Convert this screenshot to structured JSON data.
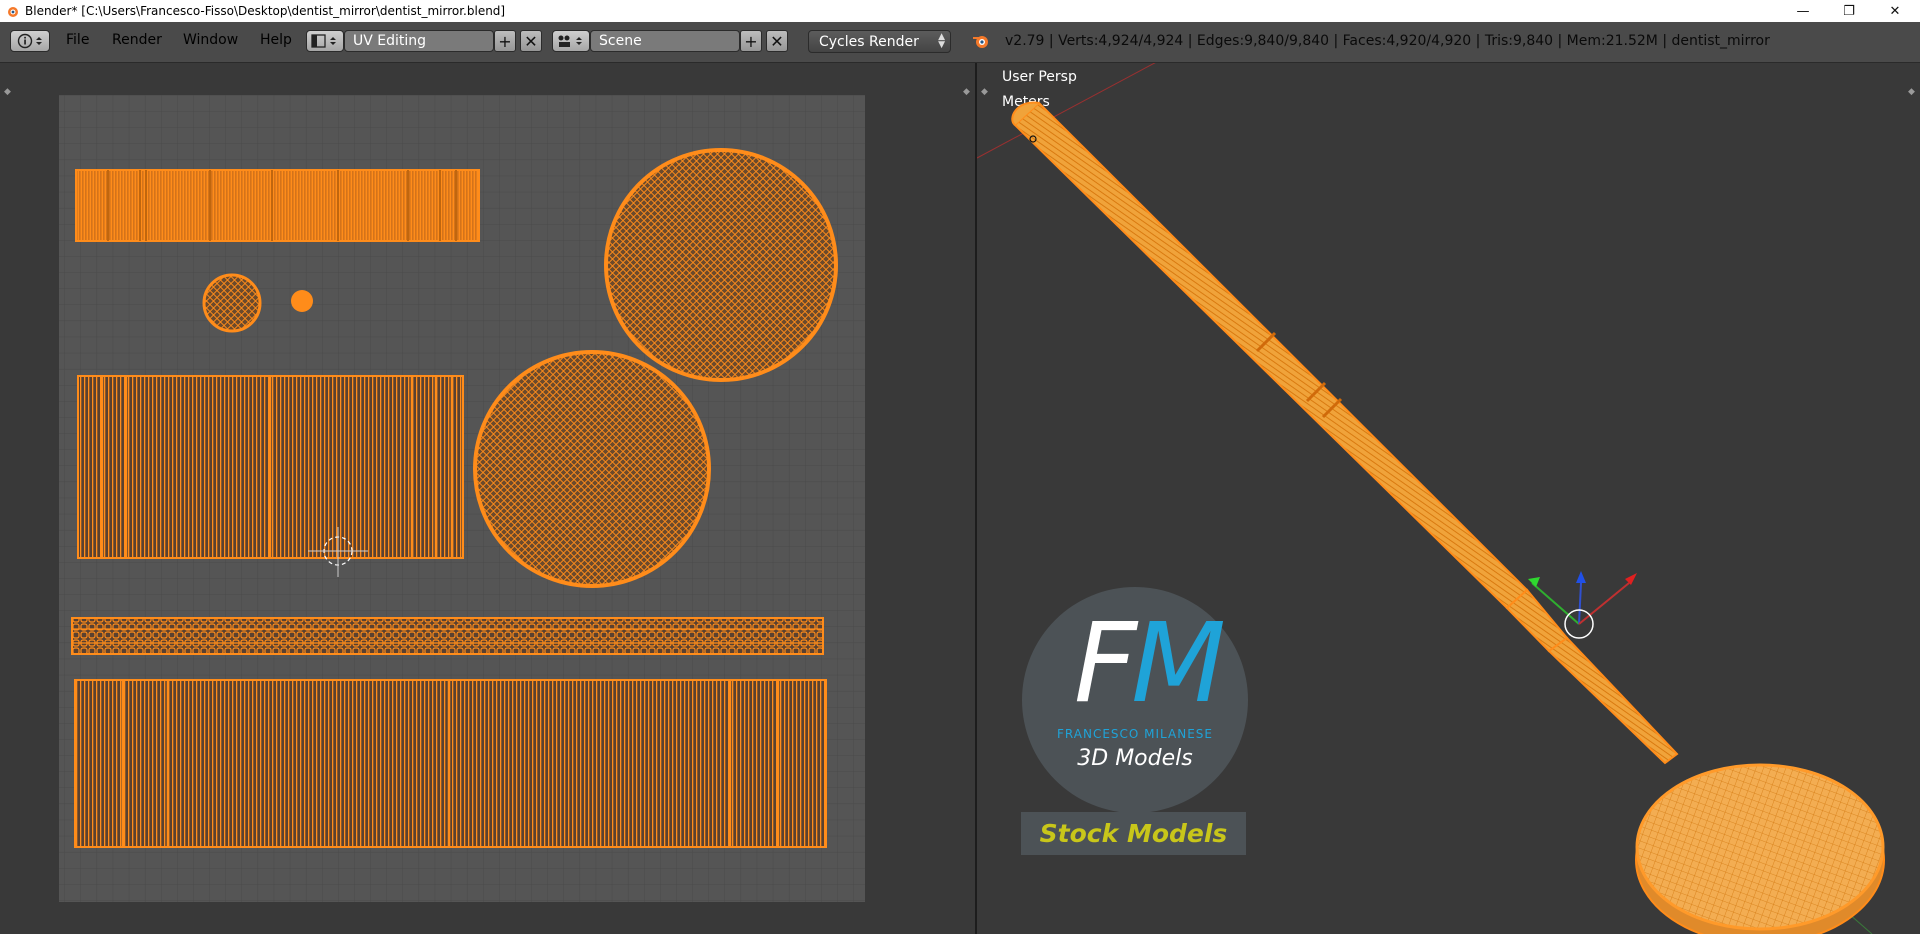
{
  "window": {
    "title": "Blender* [C:\\Users\\Francesco-Fisso\\Desktop\\dentist_mirror\\dentist_mirror.blend]",
    "controls": [
      "minimize",
      "restore",
      "close"
    ]
  },
  "header": {
    "menu": [
      "File",
      "Render",
      "Window",
      "Help"
    ],
    "screen_layout": "UV Editing",
    "scene": "Scene",
    "render_engine": "Cycles Render",
    "stats": "v2.79 | Verts:4,924/4,924 | Edges:9,840/9,840 | Faces:4,920/4,920 | Tris:9,840 | Mem:21.52M | dentist_mirror"
  },
  "viewport": {
    "view_name": "User Persp",
    "units": "Meters"
  },
  "watermark": {
    "letter_f": "F",
    "letter_m": "M",
    "name": "FRANCESCO MILANESE",
    "subtitle": "3D Models",
    "badge": "Stock Models"
  },
  "colors": {
    "accent_orange": "#ff8c1a",
    "uv_background": "#555555",
    "editor_background": "#393939",
    "watermark_blue": "#1fa3d8",
    "watermark_yellow": "#c8c61a"
  }
}
